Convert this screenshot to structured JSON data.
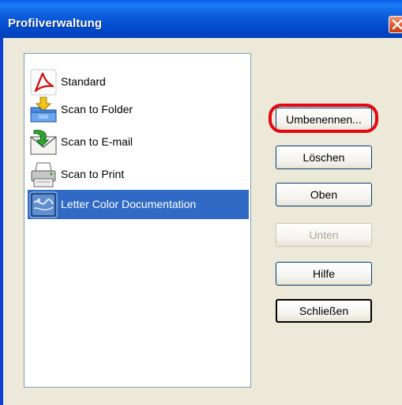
{
  "window": {
    "title": "Profilverwaltung",
    "close_icon": "close-icon"
  },
  "profiles": [
    {
      "label": "Standard",
      "icon": "pdf-icon",
      "selected": false
    },
    {
      "label": "Scan to Folder",
      "icon": "folder-scan-icon",
      "selected": false
    },
    {
      "label": "Scan to E-mail",
      "icon": "email-scan-icon",
      "selected": false
    },
    {
      "label": "Scan to Print",
      "icon": "printer-icon",
      "selected": false
    },
    {
      "label": "Letter Color Documentation",
      "icon": "document-scan-icon",
      "selected": true
    }
  ],
  "buttons": {
    "rename": "Umbenennen...",
    "delete": "Löschen",
    "up": "Oben",
    "down": "Unten",
    "help": "Hilfe",
    "close": "Schließen"
  },
  "colors": {
    "titlebar": "#0a5ad9",
    "selection": "#316ac5",
    "highlight_ring": "#e30613",
    "dialog_bg": "#ece9d8"
  }
}
